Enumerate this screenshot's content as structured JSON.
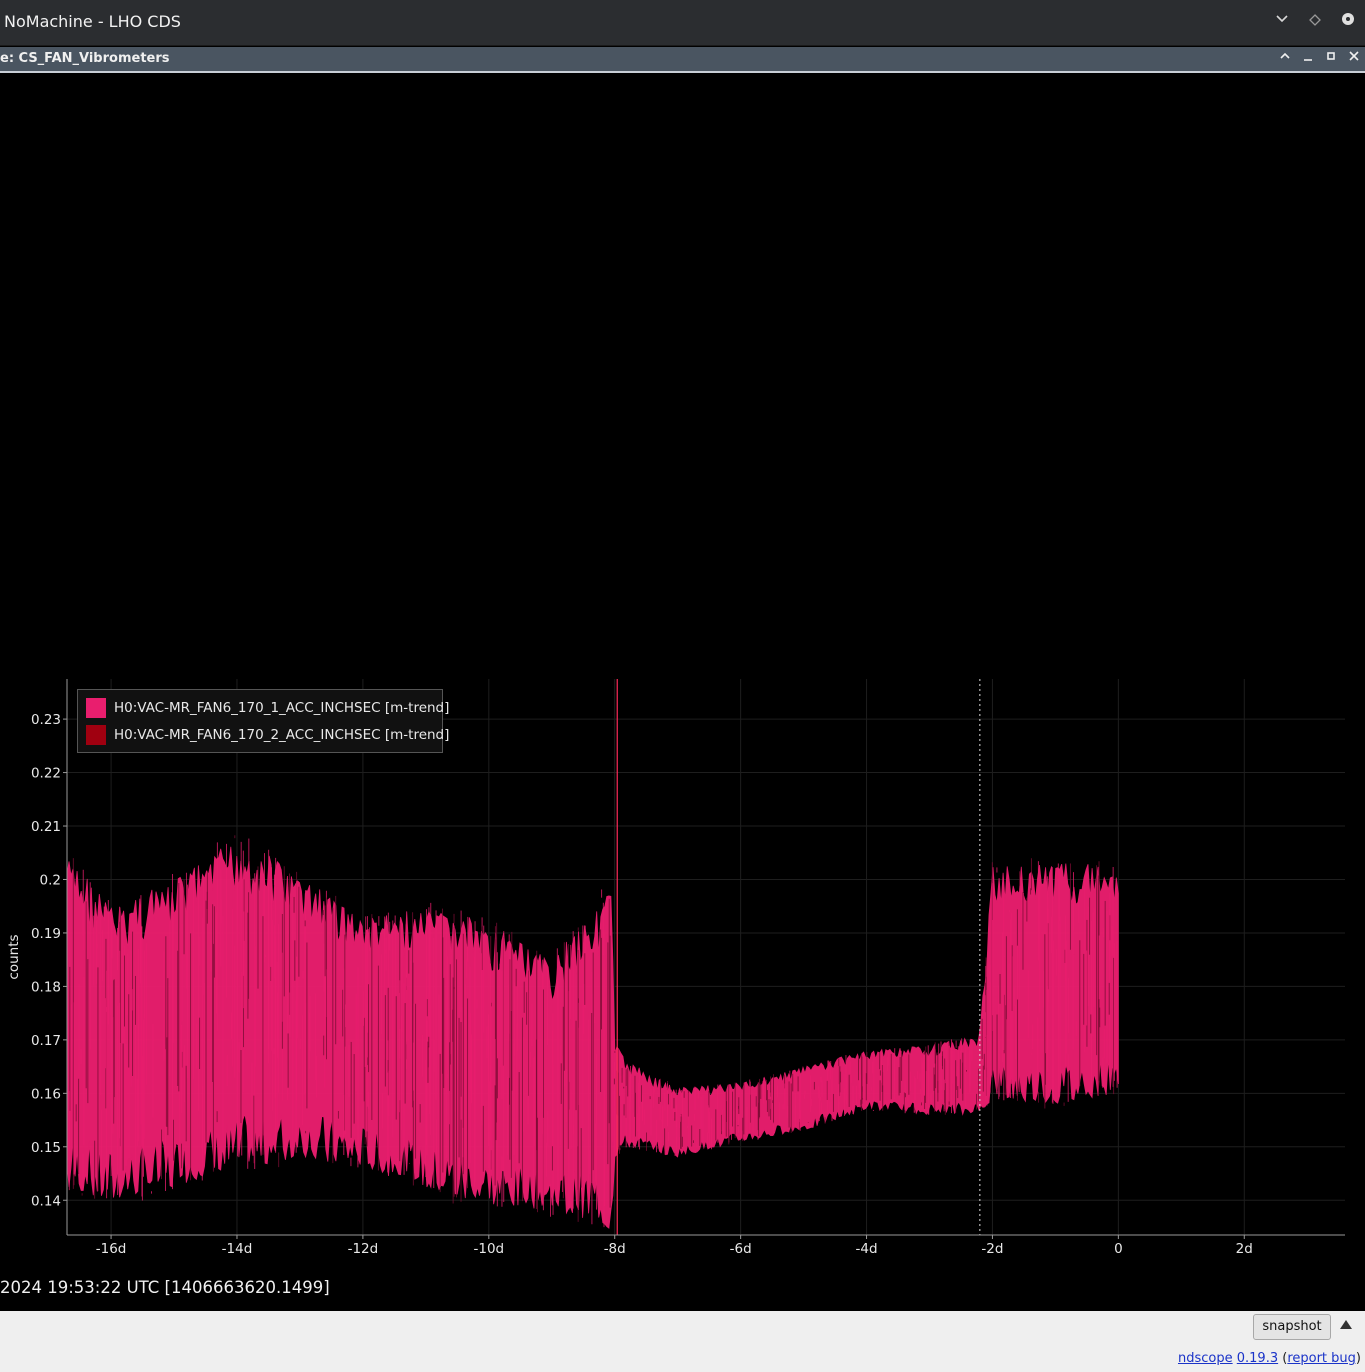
{
  "titlebar": {
    "title": "NoMachine - LHO CDS",
    "icons": [
      "chevron-down-icon",
      "diamond-icon",
      "circle-icon"
    ]
  },
  "subwindow": {
    "title": "e: CS_FAN_Vibrometers",
    "icons": [
      "chevron-up-icon",
      "minimize-icon",
      "maximize-icon",
      "close-icon"
    ]
  },
  "chart_data": {
    "type": "area",
    "ylabel": "counts",
    "xlabel": "",
    "x_tick_labels": [
      "-16d",
      "-14d",
      "-12d",
      "-10d",
      "-8d",
      "-6d",
      "-4d",
      "-2d",
      "0",
      "2d"
    ],
    "x_ticks": [
      -16,
      -14,
      -12,
      -10,
      -8,
      -6,
      -4,
      -2,
      0,
      2
    ],
    "y_tick_labels": [
      "0.14",
      "0.15",
      "0.16",
      "0.17",
      "0.18",
      "0.19",
      "0.2",
      "0.21",
      "0.22",
      "0.23"
    ],
    "y_ticks": [
      0.14,
      0.15,
      0.16,
      0.17,
      0.18,
      0.19,
      0.2,
      0.21,
      0.22,
      0.23
    ],
    "xlim": [
      -16.7,
      3.6
    ],
    "ylim": [
      0.1335,
      0.2375
    ],
    "grid": true,
    "legend_position": "top-left",
    "series": [
      {
        "name": "H0:VAC-MR_FAN6_170_1_ACC_INCHSEC [m-trend]",
        "color": "#e91e6e",
        "x": [
          -16.7,
          -16.0,
          -15.0,
          -14.0,
          -13.0,
          -12.0,
          -11.0,
          -10.0,
          -9.0,
          -8.3,
          -8.05,
          -8.0,
          -7.8,
          -7.0,
          -6.0,
          -5.0,
          -4.0,
          -3.0,
          -2.2,
          -2.0,
          -1.0,
          0.0
        ],
        "max": [
          0.205,
          0.195,
          0.2,
          0.208,
          0.201,
          0.193,
          0.195,
          0.192,
          0.185,
          0.196,
          0.198,
          0.17,
          0.166,
          0.161,
          0.162,
          0.165,
          0.168,
          0.169,
          0.171,
          0.203,
          0.203,
          0.203
        ],
        "min": [
          0.142,
          0.14,
          0.142,
          0.145,
          0.148,
          0.146,
          0.142,
          0.139,
          0.138,
          0.136,
          0.134,
          0.148,
          0.15,
          0.148,
          0.151,
          0.153,
          0.157,
          0.156,
          0.156,
          0.159,
          0.158,
          0.16
        ]
      },
      {
        "name": "H0:VAC-MR_FAN6_170_2_ACC_INCHSEC [m-trend]",
        "color": "#a00010",
        "x": [],
        "max": [],
        "min": []
      }
    ],
    "vline_solid_x": -7.96,
    "vline_dotted_x": -2.2
  },
  "timestamp": "2024 19:53:22 UTC [1406663620.1499]",
  "bottombar": {
    "snapshot_label": "snapshot",
    "expand_icon": "triangle-up-icon",
    "footer": {
      "app_link": "ndscope",
      "version_link": "0.19.3",
      "open_paren": " (",
      "bug_link": "report bug",
      "close_paren": ")"
    }
  }
}
